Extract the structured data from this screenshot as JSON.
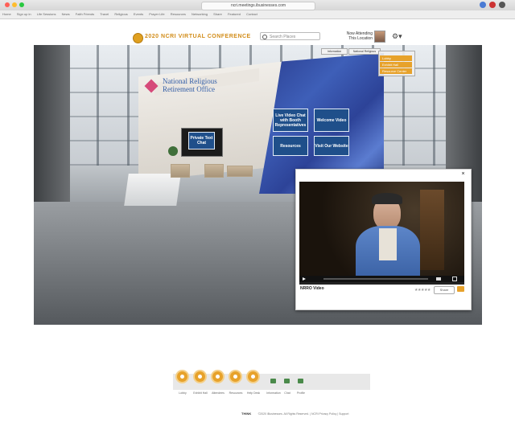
{
  "browser": {
    "url": "ncri.meetings.ibusinesses.com",
    "bookmarks": [
      "Home",
      "Sign up in",
      "Life Sessions",
      "News",
      "Faith Friends",
      "Travel",
      "Religious",
      "Events",
      "Prayer Life",
      "Resources",
      "Networking",
      "Share",
      "Featured",
      "Contact"
    ]
  },
  "header": {
    "title": "2020 NCRI VIRTUAL CONFERENCE",
    "search_placeholder": "Search Places",
    "now_attending": "Now Attending",
    "your_location": "This Location",
    "accent": "#d28d1a"
  },
  "booth": {
    "org_name_line1": "National Religious",
    "org_name_line2": "Retirement Office",
    "private_chat": "Private Text Chat",
    "buttons": {
      "live_video": "Live Video Chat with Booth Representatives",
      "welcome_video": "Welcome Video",
      "resources": "Resources",
      "visit_website": "Visit Our Website"
    },
    "brand_color": "#1f4f8a"
  },
  "nav_panel": {
    "items": [
      "Lobby",
      "Exhibit Hall",
      "Resource Center"
    ]
  },
  "video_popup": {
    "close": "×",
    "title": "NRRO Video",
    "rating": "★★★★★",
    "share": "Share"
  },
  "bottom_nav": {
    "items": [
      "Lobby",
      "Exhibit Hall",
      "Attendees",
      "Resources",
      "Help Desk"
    ],
    "extras": [
      "Information",
      "Chat",
      "Profile"
    ]
  },
  "footer": {
    "logo": "THINK",
    "text": "©2020 iBusinesses. All Rights Reserved. | NCRI Privacy Policy | Support"
  }
}
